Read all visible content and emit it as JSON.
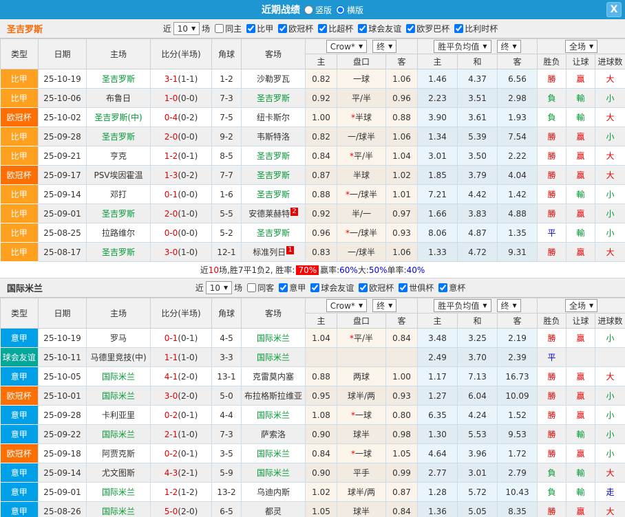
{
  "titlebar": {
    "title": "近期战绩",
    "portrait_label": "竖版",
    "portrait_selected": false,
    "landscape_label": "横版",
    "landscape_selected": true,
    "close_glyph": "X",
    "bar_color": "#1E96D2"
  },
  "table_header": {
    "main_cols": [
      "类型",
      "日期",
      "主场",
      "比分(半场)",
      "角球",
      "客场"
    ],
    "dropdown_odds": "Crow*",
    "dropdown_final1": "终",
    "dropdown_mean": "胜平负均值",
    "dropdown_final2": "终",
    "dropdown_fulltime": "全场",
    "sub_cols": [
      "主",
      "盘口",
      "客",
      "主",
      "和",
      "客",
      "胜负",
      "让球",
      "进球数"
    ]
  },
  "colors": {
    "type_map": {
      "比甲": "#FFA01E",
      "欧冠杯": "#FF6E00",
      "意甲": "#00A0E9",
      "球会友谊": "#00A899"
    },
    "result_map": {
      "勝": "red",
      "負": "green",
      "平": "blue",
      "贏": "red",
      "輸": "green",
      "大": "red",
      "小": "green",
      "走": "blue"
    },
    "team_highlight": "#009933",
    "section1_name": "#FF6600",
    "section2_name": "#333333"
  },
  "sections": [
    {
      "name": "圣吉罗斯",
      "name_color": "#FF6600",
      "filter": {
        "near_label": "近",
        "count": "10",
        "games_label": "场",
        "same_label": "同主",
        "same_checked": false,
        "leagues": [
          {
            "label": "比甲",
            "checked": true
          },
          {
            "label": "欧冠杯",
            "checked": true
          },
          {
            "label": "比超杯",
            "checked": true
          },
          {
            "label": "球会友谊",
            "checked": true
          },
          {
            "label": "欧罗巴杯",
            "checked": true
          },
          {
            "label": "比利时杯",
            "checked": true
          }
        ]
      },
      "rows": [
        {
          "type": "比甲",
          "date": "25-10-19",
          "home": "圣吉罗斯",
          "home_green": true,
          "score": "3-1",
          "half": "(1-1)",
          "corner": "1-2",
          "away": "沙勒罗瓦",
          "away_green": false,
          "away_badge": "",
          "crow": [
            "0.82",
            "一球",
            "1.06"
          ],
          "mean": [
            "1.46",
            "4.37",
            "6.56"
          ],
          "results": [
            "勝",
            "贏",
            "大"
          ]
        },
        {
          "type": "比甲",
          "date": "25-10-06",
          "home": "布鲁日",
          "home_green": false,
          "score": "1-0",
          "half": "(0-0)",
          "corner": "7-3",
          "away": "圣吉罗斯",
          "away_green": true,
          "away_badge": "",
          "crow": [
            "0.92",
            "平/半",
            "0.96"
          ],
          "mean": [
            "2.23",
            "3.51",
            "2.98"
          ],
          "results": [
            "負",
            "輸",
            "小"
          ]
        },
        {
          "type": "欧冠杯",
          "date": "25-10-02",
          "home": "圣吉罗斯(中)",
          "home_green": true,
          "score": "0-4",
          "half": "(0-2)",
          "corner": "7-5",
          "away": "纽卡斯尔",
          "away_green": false,
          "away_badge": "",
          "crow": [
            "1.00",
            "*半球",
            "0.88"
          ],
          "mean": [
            "3.90",
            "3.61",
            "1.93"
          ],
          "results": [
            "負",
            "輸",
            "大"
          ]
        },
        {
          "type": "比甲",
          "date": "25-09-28",
          "home": "圣吉罗斯",
          "home_green": true,
          "score": "2-0",
          "half": "(0-0)",
          "corner": "9-2",
          "away": "韦斯特洛",
          "away_green": false,
          "away_badge": "",
          "crow": [
            "0.82",
            "一/球半",
            "1.06"
          ],
          "mean": [
            "1.34",
            "5.39",
            "7.54"
          ],
          "results": [
            "勝",
            "贏",
            "小"
          ]
        },
        {
          "type": "比甲",
          "date": "25-09-21",
          "home": "亨克",
          "home_green": false,
          "score": "1-2",
          "half": "(0-1)",
          "corner": "8-5",
          "away": "圣吉罗斯",
          "away_green": true,
          "away_badge": "",
          "crow": [
            "0.84",
            "*平/半",
            "1.04"
          ],
          "mean": [
            "3.01",
            "3.50",
            "2.22"
          ],
          "results": [
            "勝",
            "贏",
            "大"
          ]
        },
        {
          "type": "欧冠杯",
          "date": "25-09-17",
          "home": "PSV埃因霍温",
          "home_green": false,
          "score": "1-3",
          "half": "(0-2)",
          "corner": "7-7",
          "away": "圣吉罗斯",
          "away_green": true,
          "away_badge": "",
          "crow": [
            "0.87",
            "半球",
            "1.02"
          ],
          "mean": [
            "1.85",
            "3.79",
            "4.04"
          ],
          "results": [
            "勝",
            "贏",
            "大"
          ]
        },
        {
          "type": "比甲",
          "date": "25-09-14",
          "home": "邓打",
          "home_green": false,
          "score": "0-1",
          "half": "(0-0)",
          "corner": "1-6",
          "away": "圣吉罗斯",
          "away_green": true,
          "away_badge": "",
          "crow": [
            "0.88",
            "*一/球半",
            "1.01"
          ],
          "mean": [
            "7.21",
            "4.42",
            "1.42"
          ],
          "results": [
            "勝",
            "輸",
            "小"
          ]
        },
        {
          "type": "比甲",
          "date": "25-09-01",
          "home": "圣吉罗斯",
          "home_green": true,
          "score": "2-0",
          "half": "(1-0)",
          "corner": "5-5",
          "away": "安德莱赫特",
          "away_green": false,
          "away_badge": "2",
          "crow": [
            "0.92",
            "半/一",
            "0.97"
          ],
          "mean": [
            "1.66",
            "3.83",
            "4.88"
          ],
          "results": [
            "勝",
            "贏",
            "小"
          ]
        },
        {
          "type": "比甲",
          "date": "25-08-25",
          "home": "拉路维尔",
          "home_green": false,
          "score": "0-0",
          "half": "(0-0)",
          "corner": "5-2",
          "away": "圣吉罗斯",
          "away_green": true,
          "away_badge": "",
          "crow": [
            "0.96",
            "*一/球半",
            "0.93"
          ],
          "mean": [
            "8.06",
            "4.87",
            "1.35"
          ],
          "results": [
            "平",
            "輸",
            "小"
          ]
        },
        {
          "type": "比甲",
          "date": "25-08-17",
          "home": "圣吉罗斯",
          "home_green": true,
          "score": "3-0",
          "half": "(1-0)",
          "corner": "12-1",
          "away": "标准列日",
          "away_green": false,
          "away_badge": "1",
          "crow": [
            "0.83",
            "一/球半",
            "1.06"
          ],
          "mean": [
            "1.33",
            "4.72",
            "9.31"
          ],
          "results": [
            "勝",
            "贏",
            "大"
          ]
        }
      ],
      "summary": [
        {
          "text": "近"
        },
        {
          "text": "10",
          "style": "red"
        },
        {
          "text": "场,胜7平1负2, 胜率:"
        },
        {
          "text": "70%",
          "style": "badge"
        },
        {
          "text": " 赢率:"
        },
        {
          "text": "60%",
          "style": "blue"
        },
        {
          "text": " 大:"
        },
        {
          "text": "50%",
          "style": "blue"
        },
        {
          "text": " 单率:"
        },
        {
          "text": "40%",
          "style": "blue"
        }
      ]
    },
    {
      "name": "国际米兰",
      "name_color": "#333333",
      "filter": {
        "near_label": "近",
        "count": "10",
        "games_label": "场",
        "same_label": "同客",
        "same_checked": false,
        "leagues": [
          {
            "label": "意甲",
            "checked": true
          },
          {
            "label": "球会友谊",
            "checked": true
          },
          {
            "label": "欧冠杯",
            "checked": true
          },
          {
            "label": "世俱杯",
            "checked": true
          },
          {
            "label": "意杯",
            "checked": true
          }
        ]
      },
      "rows": [
        {
          "type": "意甲",
          "date": "25-10-19",
          "home": "罗马",
          "home_green": false,
          "score": "0-1",
          "half": "(0-1)",
          "corner": "4-5",
          "away": "国际米兰",
          "away_green": true,
          "away_badge": "",
          "crow": [
            "1.04",
            "*平/半",
            "0.84"
          ],
          "mean": [
            "3.48",
            "3.25",
            "2.19"
          ],
          "results": [
            "勝",
            "贏",
            "小"
          ]
        },
        {
          "type": "球会友谊",
          "date": "25-10-11",
          "home": "马德里竞技(中)",
          "home_green": false,
          "score": "1-1",
          "half": "(1-0)",
          "corner": "3-3",
          "away": "国际米兰",
          "away_green": true,
          "away_badge": "",
          "crow": [
            "",
            "",
            ""
          ],
          "mean": [
            "2.49",
            "3.70",
            "2.39"
          ],
          "results": [
            "平",
            "",
            ""
          ]
        },
        {
          "type": "意甲",
          "date": "25-10-05",
          "home": "国际米兰",
          "home_green": true,
          "score": "4-1",
          "half": "(2-0)",
          "corner": "13-1",
          "away": "克雷莫内塞",
          "away_green": false,
          "away_badge": "",
          "crow": [
            "0.88",
            "两球",
            "1.00"
          ],
          "mean": [
            "1.17",
            "7.13",
            "16.73"
          ],
          "results": [
            "勝",
            "贏",
            "大"
          ]
        },
        {
          "type": "欧冠杯",
          "date": "25-10-01",
          "home": "国际米兰",
          "home_green": true,
          "score": "3-0",
          "half": "(2-0)",
          "corner": "5-0",
          "away": "布拉格斯拉维亚",
          "away_green": false,
          "away_badge": "",
          "crow": [
            "0.95",
            "球半/两",
            "0.93"
          ],
          "mean": [
            "1.27",
            "6.04",
            "10.09"
          ],
          "results": [
            "勝",
            "贏",
            "小"
          ]
        },
        {
          "type": "意甲",
          "date": "25-09-28",
          "home": "卡利亚里",
          "home_green": false,
          "score": "0-2",
          "half": "(0-1)",
          "corner": "4-4",
          "away": "国际米兰",
          "away_green": true,
          "away_badge": "",
          "crow": [
            "1.08",
            "*一球",
            "0.80"
          ],
          "mean": [
            "6.35",
            "4.24",
            "1.52"
          ],
          "results": [
            "勝",
            "贏",
            "小"
          ]
        },
        {
          "type": "意甲",
          "date": "25-09-22",
          "home": "国际米兰",
          "home_green": true,
          "score": "2-1",
          "half": "(1-0)",
          "corner": "7-3",
          "away": "萨索洛",
          "away_green": false,
          "away_badge": "",
          "crow": [
            "0.90",
            "球半",
            "0.98"
          ],
          "mean": [
            "1.30",
            "5.53",
            "9.53"
          ],
          "results": [
            "勝",
            "輸",
            "小"
          ]
        },
        {
          "type": "欧冠杯",
          "date": "25-09-18",
          "home": "阿贾克斯",
          "home_green": false,
          "score": "0-2",
          "half": "(0-1)",
          "corner": "3-5",
          "away": "国际米兰",
          "away_green": true,
          "away_badge": "",
          "crow": [
            "0.84",
            "*一球",
            "1.05"
          ],
          "mean": [
            "4.64",
            "3.96",
            "1.72"
          ],
          "results": [
            "勝",
            "贏",
            "小"
          ]
        },
        {
          "type": "意甲",
          "date": "25-09-14",
          "home": "尤文图斯",
          "home_green": false,
          "score": "4-3",
          "half": "(2-1)",
          "corner": "5-9",
          "away": "国际米兰",
          "away_green": true,
          "away_badge": "",
          "crow": [
            "0.90",
            "平手",
            "0.99"
          ],
          "mean": [
            "2.77",
            "3.01",
            "2.79"
          ],
          "results": [
            "負",
            "輸",
            "大"
          ]
        },
        {
          "type": "意甲",
          "date": "25-09-01",
          "home": "国际米兰",
          "home_green": true,
          "score": "1-2",
          "half": "(1-2)",
          "corner": "13-2",
          "away": "乌迪内斯",
          "away_green": false,
          "away_badge": "",
          "crow": [
            "1.02",
            "球半/两",
            "0.87"
          ],
          "mean": [
            "1.28",
            "5.72",
            "10.43"
          ],
          "results": [
            "負",
            "輸",
            "走"
          ]
        },
        {
          "type": "意甲",
          "date": "25-08-26",
          "home": "国际米兰",
          "home_green": true,
          "score": "5-0",
          "half": "(2-0)",
          "corner": "6-5",
          "away": "都灵",
          "away_green": false,
          "away_badge": "",
          "crow": [
            "1.05",
            "球半",
            "0.84"
          ],
          "mean": [
            "1.36",
            "5.05",
            "8.35"
          ],
          "results": [
            "勝",
            "贏",
            "大"
          ]
        }
      ],
      "summary": null
    }
  ]
}
